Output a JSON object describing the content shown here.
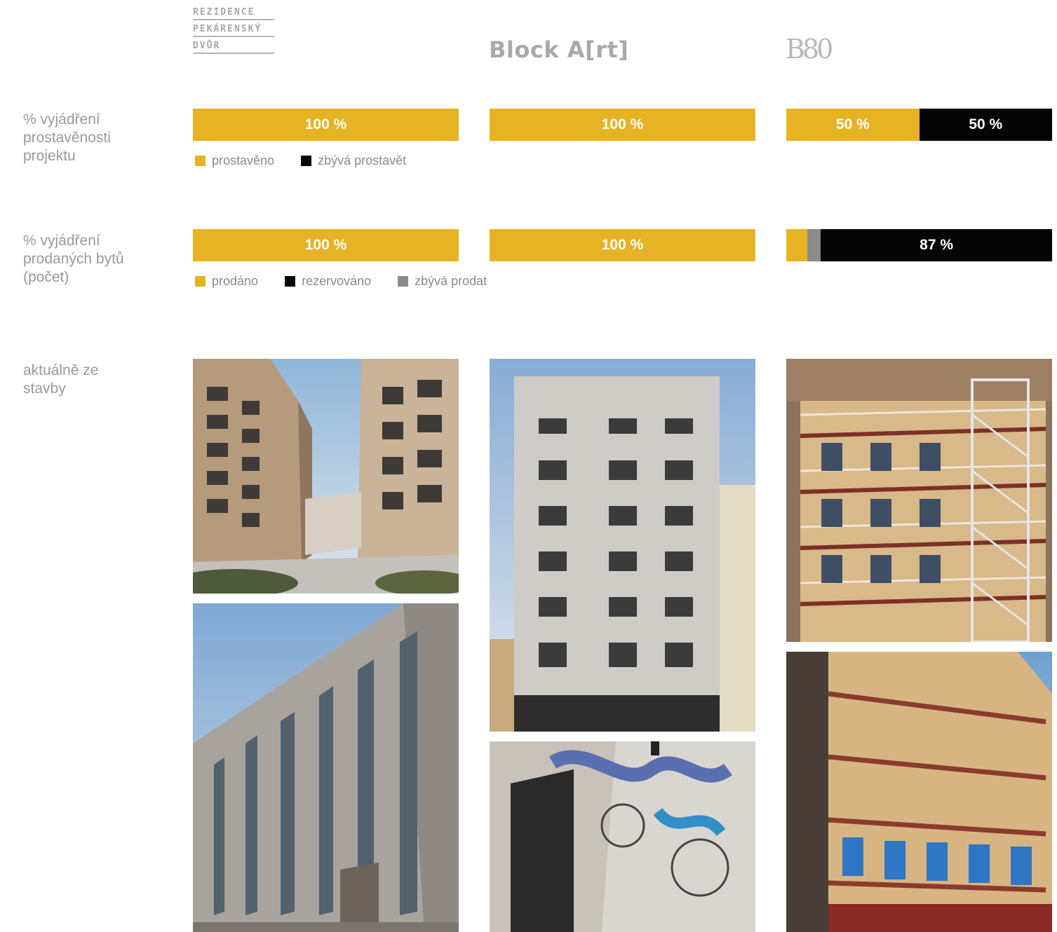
{
  "colors": {
    "gold": "#e6b325",
    "black": "#050505",
    "gray": "#8b8b8b"
  },
  "projects": [
    {
      "logo_lines": [
        "REZIDENCE",
        "PEKÁRENSKÝ",
        "DVŮR"
      ]
    },
    {
      "logo": "Block A[rt]"
    },
    {
      "logo": "B80"
    }
  ],
  "rows": {
    "construction": {
      "label": "% vyjádření prostavěnosti projektu",
      "legend": [
        "prostavěno",
        "zbývá prostavět"
      ],
      "bars": [
        {
          "built_pct": 100,
          "remaining_pct": 0,
          "label": "100 %"
        },
        {
          "built_pct": 100,
          "remaining_pct": 0,
          "label": "100 %"
        },
        {
          "built_pct": 50,
          "remaining_pct": 50,
          "labels": [
            "50 %",
            "50 %"
          ]
        }
      ]
    },
    "sales": {
      "label": "% vyjádření prodaných bytů (počet)",
      "legend": [
        "prodáno",
        "rezervováno",
        "zbývá prodat"
      ],
      "bars": [
        {
          "sold_pct": 100,
          "reserved_pct": 0,
          "remaining_pct": 0,
          "label": "100 %"
        },
        {
          "sold_pct": 100,
          "reserved_pct": 0,
          "remaining_pct": 0,
          "label": "100 %"
        },
        {
          "sold_pct": 8,
          "reserved_pct": 5,
          "remaining_pct": 87,
          "label": "87 %"
        }
      ]
    },
    "photos": {
      "label": "aktuálně ze stavby"
    }
  }
}
